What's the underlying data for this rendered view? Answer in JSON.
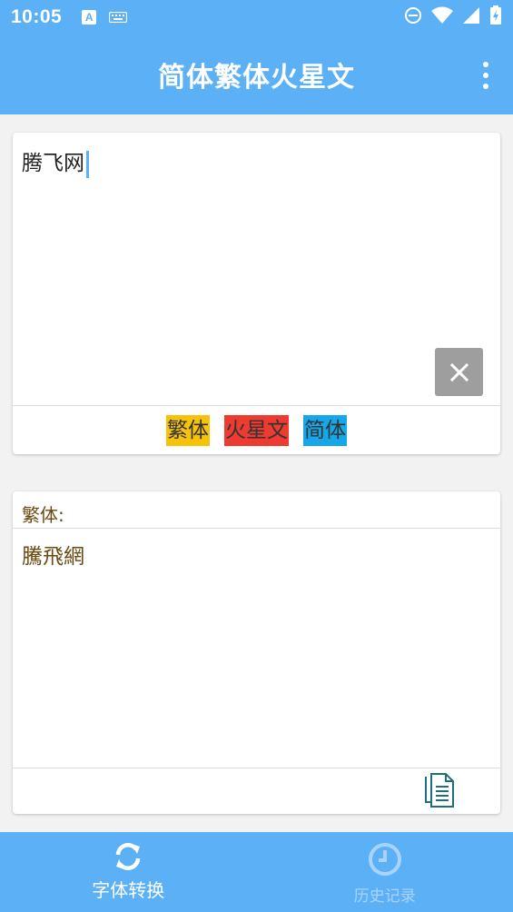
{
  "status_bar": {
    "time": "10:05",
    "notification_icons": [
      "a-badge-icon",
      "keyboard-icon"
    ],
    "system_icons": [
      "do-not-disturb-icon",
      "wifi-icon",
      "signal-icon",
      "battery-icon"
    ],
    "a_badge_text": "A"
  },
  "app_bar": {
    "title": "简体繁体火星文",
    "menu_icon": "more-vert-icon"
  },
  "input": {
    "value": "腾飞网",
    "clear_icon": "close-icon"
  },
  "convert_options": [
    {
      "label": "繁体",
      "color": "#f7c30a"
    },
    {
      "label": "火星文",
      "color": "#ee3b32"
    },
    {
      "label": "简体",
      "color": "#15a7e8"
    }
  ],
  "output": {
    "label": "繁体:",
    "value": "騰飛網",
    "copy_icon": "copy-document-icon"
  },
  "bottom_nav": {
    "items": [
      {
        "label": "字体转换",
        "icon": "sync-icon",
        "active": true
      },
      {
        "label": "历史记录",
        "icon": "clock-icon",
        "active": false
      }
    ]
  },
  "colors": {
    "primary": "#5cb0f6",
    "output_text": "#6b4a12",
    "clear_button": "#9e9e9e"
  }
}
